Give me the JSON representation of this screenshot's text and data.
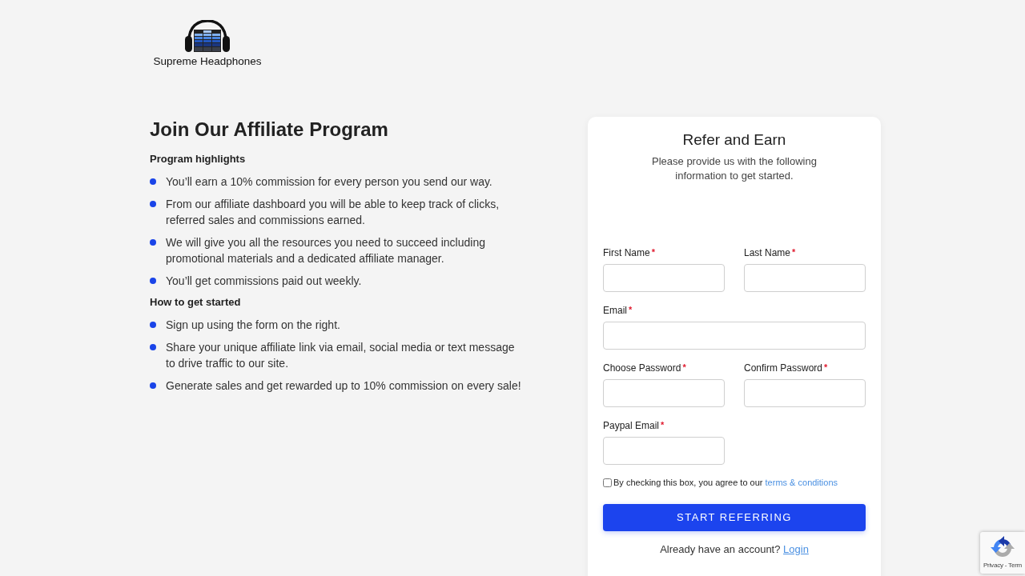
{
  "brand": {
    "name": "Supreme Headphones"
  },
  "intro": {
    "title": "Join Our Affiliate Program",
    "sections": [
      {
        "heading": "Program highlights",
        "items": [
          "You’ll earn a 10% commission for every person you send our way.",
          "From our affiliate dashboard you will be able to keep track of clicks, referred sales and commissions earned.",
          "We will give you all the resources you need to succeed including promotional materials and a dedicated affiliate manager.",
          "You’ll get commissions paid out weekly."
        ]
      },
      {
        "heading": "How to get started",
        "items": [
          "Sign up using the form on the right.",
          "Share your unique affiliate link via email, social media or text message to drive traffic to our site.",
          "Generate sales and get rewarded up to 10% commission on every sale!"
        ]
      }
    ]
  },
  "form": {
    "title": "Refer and Earn",
    "subtitle": "Please provide us with the following information to get started.",
    "fields": [
      {
        "label": "First Name",
        "required_mark": "*"
      },
      {
        "label": "Last Name",
        "required_mark": "*"
      },
      {
        "label": "Email",
        "required_mark": "*"
      },
      {
        "label": "Choose Password",
        "required_mark": "*"
      },
      {
        "label": "Confirm Password",
        "required_mark": "*"
      },
      {
        "label": "Paypal Email",
        "required_mark": "*"
      }
    ],
    "agreement": {
      "checked": false,
      "text": "By checking this box, you agree to our",
      "link": "terms & conditions"
    },
    "submit": {
      "label": "START REFERRING"
    },
    "login_prompt": {
      "text": "Already have an account?",
      "link": "Login"
    }
  },
  "captcha_badge": {
    "text": "Privacy - Term"
  }
}
